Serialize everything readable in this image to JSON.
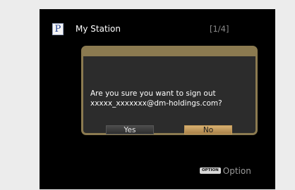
{
  "header": {
    "logo_letter": "P",
    "title": "My Station",
    "page_indicator": "[1/4]"
  },
  "dialog": {
    "message_line1": "Are you sure you want to sign out",
    "message_line2": "xxxxx_xxxxxxx@dm-holdings.com?",
    "yes_label": "Yes",
    "no_label": "No",
    "selected": "No"
  },
  "footer": {
    "option_key_label": "OPTION",
    "option_label": "Option"
  },
  "colors": {
    "accent": "#8b7a50",
    "selected_button": "#c9a060",
    "background": "#000000"
  },
  "icons": {
    "logo": "pandora-p-logo"
  }
}
